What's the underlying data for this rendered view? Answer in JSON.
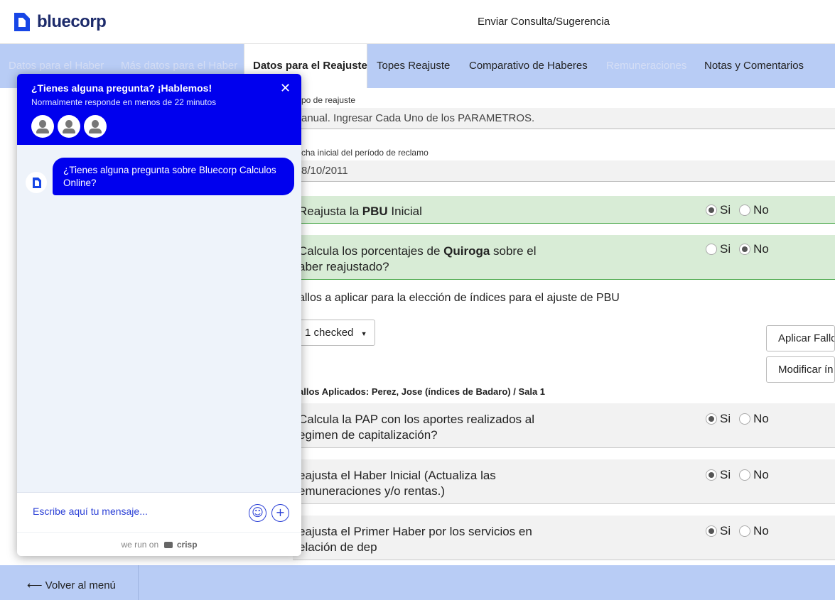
{
  "header": {
    "logo_text": "bluecorp",
    "link": "Enviar Consulta/Sugerencia"
  },
  "tabs": [
    {
      "label": "Datos para el Haber",
      "state": "disabled"
    },
    {
      "label": "Más datos para el Haber",
      "state": "disabled"
    },
    {
      "label": "Datos para el Reajuste",
      "state": "active"
    },
    {
      "label": "Topes Reajuste",
      "state": "normal"
    },
    {
      "label": "Comparativo de Haberes",
      "state": "normal"
    },
    {
      "label": "Remuneraciones",
      "state": "disabled"
    },
    {
      "label": "Notas y Comentarios",
      "state": "normal"
    }
  ],
  "form": {
    "tipo_label": "po de reajuste",
    "tipo_value": "anual. Ingresar Cada Uno de los PARAMETROS.",
    "fecha_label": "cha inicial del período de reclamo",
    "fecha_value": "8/10/2011",
    "pbu": {
      "pre": "Reajusta la ",
      "bold": "PBU",
      "post": " Inicial",
      "si": "Si",
      "no": "No",
      "selected": "si"
    },
    "quiroga": {
      "pre": "Calcula los porcentajes de ",
      "bold": "Quiroga",
      "post": " sobre el",
      "line2": "aber reajustado?",
      "si": "Si",
      "no": "No",
      "selected": "no"
    },
    "fallos_text": "allos a aplicar para la elección de índices para el ajuste de PBU",
    "dropdown_value": "1 checked",
    "btn_aplicar": "Aplicar Fallo",
    "btn_modificar": "Modificar ín",
    "fallos_aplicados": "allos Aplicados: Perez, Jose (índices de Badaro)  /  Sala 1",
    "pap": {
      "line1": "Calcula la PAP con los aportes realizados al",
      "line2": "egimen de capitalización?",
      "si": "Si",
      "no": "No",
      "selected": "si"
    },
    "haber_inicial": {
      "line1": "eajusta el Haber Inicial (Actualiza las",
      "line2": "emuneraciones y/o rentas.)",
      "si": "Si",
      "no": "No",
      "selected": "si"
    },
    "primer_haber": {
      "line1": "eajusta el Primer Haber por los servicios en",
      "line2": "elación de dep",
      "si": "Si",
      "no": "No",
      "selected": "si"
    }
  },
  "footer": {
    "back": "⟵ Volver al menú"
  },
  "chat": {
    "title": "¿Tienes alguna pregunta? ¡Hablemos!",
    "subtitle": "Normalmente responde en menos de 22 minutos",
    "close": "✕",
    "message": "¿Tienes alguna pregunta sobre Bluecorp Calculos Online?",
    "placeholder": "Escribe aquí tu mensaje...",
    "emoji": "☺",
    "plus": "+",
    "powered_prefix": "we run on ",
    "powered_brand": "crisp"
  },
  "colors": {
    "brand_blue": "#0000ee",
    "tab_bar": "#b8ccf5",
    "green_row": "#d8ecd6"
  }
}
